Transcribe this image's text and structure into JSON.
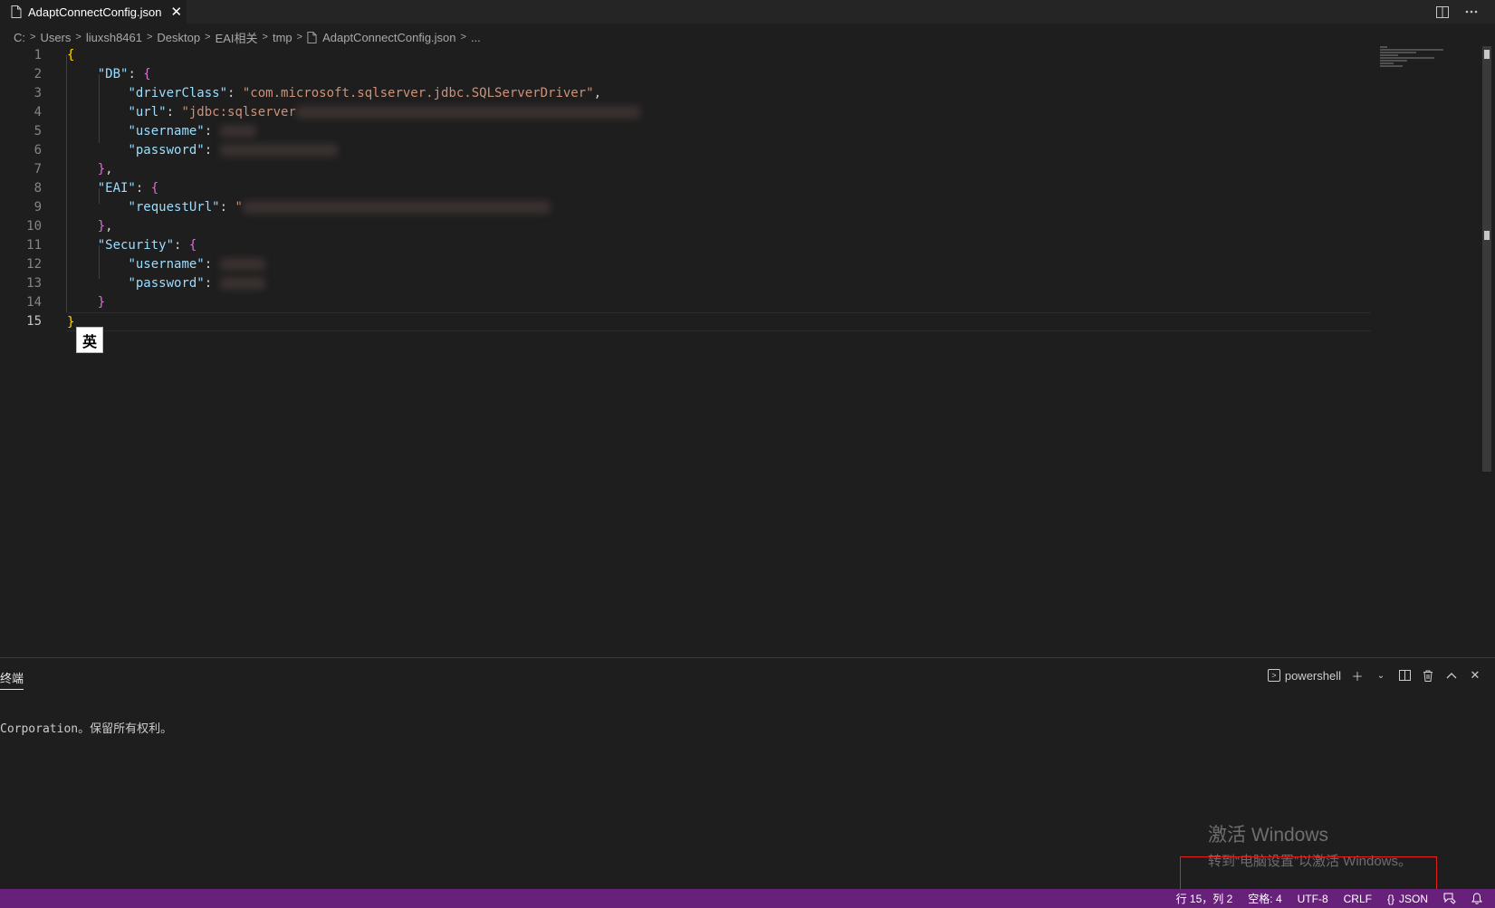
{
  "tab": {
    "filename": "AdaptConnectConfig.json",
    "close_glyph": "✕"
  },
  "breadcrumb": [
    "C:",
    "Users",
    "liuxsh8461",
    "Desktop",
    "EAI相关",
    "tmp",
    "AdaptConnectConfig.json",
    "..."
  ],
  "editor": {
    "line_numbers": [
      "1",
      "2",
      "3",
      "4",
      "5",
      "6",
      "7",
      "8",
      "9",
      "10",
      "11",
      "12",
      "13",
      "14",
      "15"
    ],
    "active_line": "15",
    "db_key": "\"DB\"",
    "driver_key": "\"driverClass\"",
    "driver_value": "\"com.microsoft.sqlserver.jdbc.SQLServerDriver\"",
    "url_key": "\"url\"",
    "url_value": "\"jdbc:sqlserver",
    "username_key": "\"username\"",
    "password_key": "\"password\"",
    "eai_key": "\"EAI\"",
    "requesturl_key": "\"requestUrl\"",
    "requesturl_value": "\"",
    "security_key": "\"Security\"",
    "ime_indicator": "英"
  },
  "panel": {
    "tab_label": "终端",
    "shell_label": "powershell",
    "terminal_output": "Corporation。保留所有权利。"
  },
  "watermark": {
    "line1": "激活 Windows",
    "line2": "转到“电脑设置”以激活 Windows。"
  },
  "statusbar": {
    "position": "行 15，列 2",
    "spaces": "空格: 4",
    "encoding": "UTF-8",
    "eol": "CRLF",
    "language": "JSON"
  }
}
